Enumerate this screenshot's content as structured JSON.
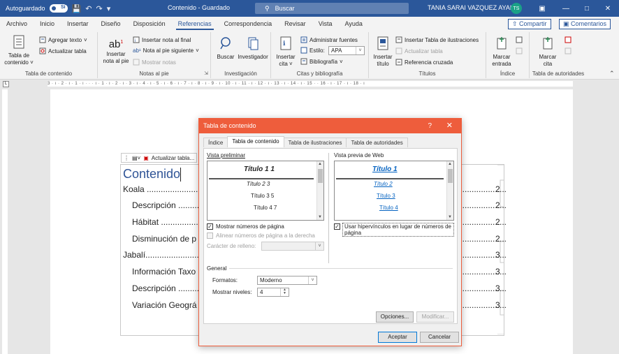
{
  "titlebar": {
    "autosave_label": "Autoguardado",
    "autosave_state": "Sí",
    "doc_title": "Contenido - Guardado",
    "search_placeholder": "Buscar",
    "user_name": "TANIA SARAI VAZQUEZ AYALA",
    "user_initials": "TS"
  },
  "menu_tabs": [
    "Archivo",
    "Inicio",
    "Insertar",
    "Diseño",
    "Disposición",
    "Referencias",
    "Correspondencia",
    "Revisar",
    "Vista",
    "Ayuda"
  ],
  "share_label": "Compartir",
  "comments_label": "Comentarios",
  "ribbon": {
    "toc_group": {
      "big_label_1": "Tabla de",
      "big_label_2": "contenido",
      "add_text": "Agregar texto",
      "update_table": "Actualizar tabla",
      "label": "Tabla de contenido"
    },
    "footnotes_group": {
      "insert_footnote_1": "Insertar",
      "insert_footnote_2": "nota al pie",
      "insert_endnote": "Insertar nota al final",
      "next_footnote": "Nota al pie siguiente",
      "show_notes": "Mostrar notas",
      "label": "Notas al pie"
    },
    "research_group": {
      "search": "Buscar",
      "researcher": "Investigador",
      "label": "Investigación"
    },
    "citations_group": {
      "insert_citation_1": "Insertar",
      "insert_citation_2": "cita",
      "manage_sources": "Administrar fuentes",
      "style_label": "Estilo:",
      "style_value": "APA",
      "bibliography": "Bibliografía",
      "label": "Citas y bibliografía"
    },
    "captions_group": {
      "insert_caption_1": "Insertar",
      "insert_caption_2": "título",
      "insert_table_figures": "Insertar Tabla de ilustraciones",
      "update_table": "Actualizar tabla",
      "cross_reference": "Referencia cruzada",
      "label": "Títulos"
    },
    "index_group": {
      "mark_entry_1": "Marcar",
      "mark_entry_2": "entrada",
      "label": "Índice"
    },
    "authorities_group": {
      "mark_citation_1": "Marcar",
      "mark_citation_2": "cita",
      "label": "Tabla de autoridades"
    }
  },
  "ruler_text": "3 · ı · 2 · ı · 1 · ı ·  ·  · ı · 1 · ı · 2 · ı · 3 · ı · 4 · ı · 5 · ı · 6 · ı · 7 · ı · 8 · ı · 9 · ı · 10 · ı · 11 · ı · 12 · ı · 13 · ı · 14 · ı · 15 ·  · 16 · ı · 17 · ı · 18 · ı",
  "document": {
    "toc_toolbar_label": "Actualizar tabla...",
    "toc_heading": "Contenido",
    "entries": [
      {
        "text": "Koala ..............................",
        "page": "2"
      },
      {
        "text": "Descripción ................",
        "page": "2"
      },
      {
        "text": "Hábitat .......................",
        "page": "2"
      },
      {
        "text": "Disminución de p",
        "page": "2"
      },
      {
        "text": "Jabalí...............................",
        "page": "3"
      },
      {
        "text": "Información Taxo",
        "page": "3"
      },
      {
        "text": "Descripción ................",
        "page": "3"
      },
      {
        "text": "Variación Geográ",
        "page": "3"
      }
    ],
    "right_dots": "....................."
  },
  "dialog": {
    "title": "Tabla de contenido",
    "help": "?",
    "close": "✕",
    "tabs": [
      "Índice",
      "Tabla de contenido",
      "Tabla de ilustraciones",
      "Tabla de autoridades"
    ],
    "print_preview_label": "Vista preliminar",
    "print_preview_items": [
      "Título 1 1",
      "Título 2 3",
      "Título 3 5",
      "Título 4 7"
    ],
    "web_preview_label": "Vista previa de Web",
    "web_preview_items": [
      "Título 1",
      "Título 2",
      "Título 3",
      "Título 4"
    ],
    "show_page_numbers": "Mostrar números de página",
    "align_page_numbers": "Alinear números de página a la derecha",
    "tab_leader_label": "Carácter de relleno:",
    "use_hyperlinks_1": "Usar hipervínculos en lugar de números de",
    "use_hyperlinks_2": "página",
    "general_label": "General",
    "formats_label": "Formatos:",
    "formats_value": "Moderno",
    "levels_label": "Mostrar niveles:",
    "levels_value": "4",
    "options_button": "Opciones...",
    "modify_button": "Modificar...",
    "ok_button": "Aceptar",
    "cancel_button": "Cancelar",
    "checked_mark": "✓"
  },
  "colors": {
    "word_blue": "#2b579a",
    "dialog_accent": "#ee5d3c",
    "heading_blue": "#2f5496",
    "link_blue": "#0563c1"
  }
}
